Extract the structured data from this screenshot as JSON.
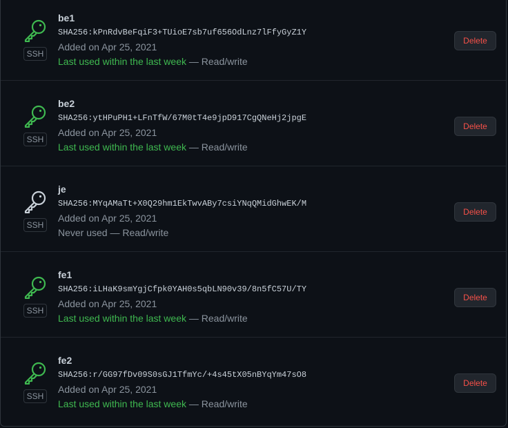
{
  "keys": [
    {
      "title": "be1",
      "fingerprint": "SHA256:kPnRdvBeFqiF3+TUioE7sb7uf656OdLnz7lFfyGyZ1Y",
      "added": "Added on Apr 25, 2021",
      "usage": "Last used within the last week",
      "access": " — Read/write",
      "recently_used": true,
      "badge": "SSH",
      "delete_label": "Delete"
    },
    {
      "title": "be2",
      "fingerprint": "SHA256:ytHPuPH1+LFnTfW/67M0tT4e9jpD917CgQNeHj2jpgE",
      "added": "Added on Apr 25, 2021",
      "usage": "Last used within the last week",
      "access": " — Read/write",
      "recently_used": true,
      "badge": "SSH",
      "delete_label": "Delete"
    },
    {
      "title": "je",
      "fingerprint": "SHA256:MYqAMaTt+X0Q29hm1EkTwvABy7csiYNqQMidGhwEK/M",
      "added": "Added on Apr 25, 2021",
      "usage": "Never used",
      "access": " — Read/write",
      "recently_used": false,
      "badge": "SSH",
      "delete_label": "Delete"
    },
    {
      "title": "fe1",
      "fingerprint": "SHA256:iLHaK9smYgjCfpk0YAH0s5qbLN90v39/8n5fC57U/TY",
      "added": "Added on Apr 25, 2021",
      "usage": "Last used within the last week",
      "access": " — Read/write",
      "recently_used": true,
      "badge": "SSH",
      "delete_label": "Delete"
    },
    {
      "title": "fe2",
      "fingerprint": "SHA256:r/GG97fDv09S0sGJ1TfmYc/+4s45tX05nBYqYm47sO8",
      "added": "Added on Apr 25, 2021",
      "usage": "Last used within the last week",
      "access": " — Read/write",
      "recently_used": true,
      "badge": "SSH",
      "delete_label": "Delete"
    }
  ],
  "colors": {
    "background": "#0d1117",
    "border": "#30363d",
    "text_primary": "#c9d1d9",
    "text_muted": "#8b949e",
    "recent_green": "#3fb950",
    "delete_red": "#f85149",
    "button_bg": "#21262d"
  },
  "icons": {
    "recent": "key-icon-green",
    "unused": "key-icon-white"
  }
}
